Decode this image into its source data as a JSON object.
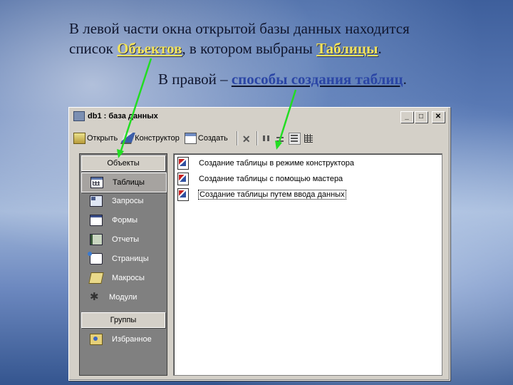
{
  "slide": {
    "line1": "В левой части окна открытой базы данных находится",
    "line2_prefix": "список ",
    "line2_link1": "Объектов",
    "line2_mid": ", в котором выбраны ",
    "line2_link2": "Таблицы",
    "line2_suffix": ".",
    "line3_prefix": "В правой  – ",
    "line3_link": "способы создания таблиц",
    "line3_suffix": "."
  },
  "window": {
    "title": "db1 : база данных",
    "minimize": "_",
    "maximize": "□",
    "close": "✕"
  },
  "toolbar": {
    "open_label": "Открыть",
    "constructor_label": "Конструктор",
    "create_label": "Создать",
    "delete_icon": "delete-icon"
  },
  "left_panel": {
    "objects_header": "Объекты",
    "groups_header": "Группы",
    "items": [
      {
        "label": "Таблицы",
        "icon": "table-icon",
        "selected": true
      },
      {
        "label": "Запросы",
        "icon": "query-icon"
      },
      {
        "label": "Формы",
        "icon": "form-icon"
      },
      {
        "label": "Отчеты",
        "icon": "report-icon"
      },
      {
        "label": "Страницы",
        "icon": "page-icon"
      },
      {
        "label": "Макросы",
        "icon": "macro-icon"
      },
      {
        "label": "Модули",
        "icon": "module-icon"
      }
    ],
    "group_items": [
      {
        "label": "Избранное",
        "icon": "favorites-icon"
      }
    ]
  },
  "right_panel": {
    "items": [
      {
        "label": "Создание таблицы в режиме конструктора"
      },
      {
        "label": "Создание таблицы с помощью мастера"
      },
      {
        "label": "Создание таблицы путем ввода данных",
        "focused": true
      }
    ]
  },
  "colors": {
    "highlight_yellow": "#f3e35a",
    "highlight_blue": "#2b46a6",
    "arrow_green": "#22dd22",
    "window_face": "#d4d0c8"
  }
}
